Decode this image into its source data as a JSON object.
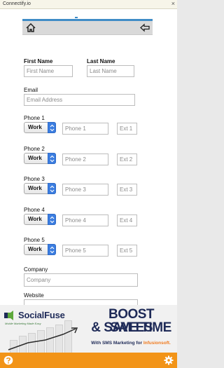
{
  "app": {
    "title": "Connectify.io",
    "close_glyph": "×"
  },
  "toolbar": {
    "home_icon": "home-icon",
    "back_icon": "back-arrow-icon"
  },
  "form": {
    "first_name_label": "First Name",
    "first_name_placeholder": "First Name",
    "last_name_label": "Last Name",
    "last_name_placeholder": "Last Name",
    "email_label": "Email",
    "email_placeholder": "Email Address",
    "phones": [
      {
        "label": "Phone 1",
        "type": "Work",
        "placeholder": "Phone 1",
        "ext_placeholder": "Ext 1"
      },
      {
        "label": "Phone 2",
        "type": "Work",
        "placeholder": "Phone 2",
        "ext_placeholder": "Ext 2"
      },
      {
        "label": "Phone 3",
        "type": "Work",
        "placeholder": "Phone 3",
        "ext_placeholder": "Ext 3"
      },
      {
        "label": "Phone 4",
        "type": "Work",
        "placeholder": "Phone 4",
        "ext_placeholder": "Ext 4"
      },
      {
        "label": "Phone 5",
        "type": "Work",
        "placeholder": "Phone 5",
        "ext_placeholder": "Ext 5"
      }
    ],
    "company_label": "Company",
    "company_placeholder": "Company",
    "website_label": "Website"
  },
  "ad": {
    "brand": "SocialFuse",
    "tagline": "Mobile Marketing Made Easy",
    "headline1": "BOOST SALES",
    "headline2": "& SAVE TIME",
    "sub_prefix": "With SMS Marketing for ",
    "sub_brand": "Infusionsoft."
  },
  "footer": {
    "help_icon": "help-icon",
    "settings_icon": "gear-icon"
  },
  "colors": {
    "accent": "#3f8cc7",
    "footer": "#f29418",
    "select": "#3b7de0",
    "ad_navy": "#1e2a57",
    "ad_orange": "#f07a1e"
  }
}
